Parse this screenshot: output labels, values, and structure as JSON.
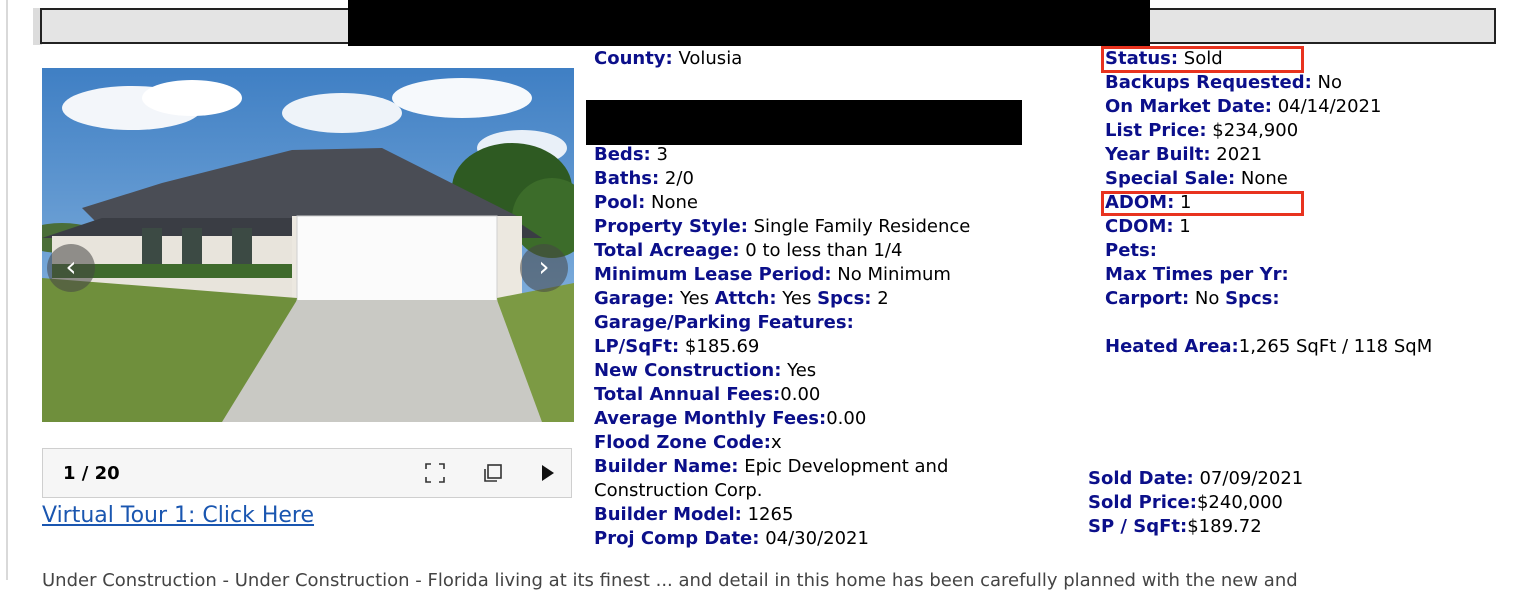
{
  "gallery": {
    "counter": "1 / 20",
    "tour_link": "Virtual Tour 1: Click Here"
  },
  "middle": [
    {
      "label": "County:",
      "value": " Volusia"
    },
    {
      "label": "Beds:",
      "value": " 3"
    },
    {
      "label": "Baths:",
      "value": " 2/0"
    },
    {
      "label": "Pool:",
      "value": " None"
    },
    {
      "label": "Property Style:",
      "value": " Single Family Residence"
    },
    {
      "label": "Total Acreage:",
      "value": " 0 to less than 1/4"
    },
    {
      "label": "Minimum Lease Period:",
      "value": " No Minimum"
    },
    {
      "label": "Garage:",
      "value": " Yes "
    },
    {
      "label": "Attch:",
      "value": " Yes "
    },
    {
      "label": "Spcs:",
      "value": " 2"
    },
    {
      "label": "Garage/Parking Features:",
      "value": ""
    },
    {
      "label": "LP/SqFt:",
      "value": " $185.69"
    },
    {
      "label": "New Construction:",
      "value": " Yes"
    },
    {
      "label": "Total Annual Fees:",
      "value": "0.00"
    },
    {
      "label": "Average Monthly Fees:",
      "value": "0.00"
    },
    {
      "label": "Flood Zone Code:",
      "value": "x"
    },
    {
      "label": "Builder Name:",
      "value": " Epic Development and"
    },
    {
      "label": "",
      "value": "Construction Corp."
    },
    {
      "label": "Builder Model:",
      "value": " 1265"
    },
    {
      "label": "Proj Comp Date:",
      "value": " 04/30/2021"
    }
  ],
  "right": [
    {
      "label": "Status:",
      "value": " Sold"
    },
    {
      "label": "Backups Requested:",
      "value": " No"
    },
    {
      "label": "On Market Date:",
      "value": " 04/14/2021"
    },
    {
      "label": "List Price:",
      "value": " $234,900"
    },
    {
      "label": "Year Built:",
      "value": " 2021"
    },
    {
      "label": "Special Sale:",
      "value": " None"
    },
    {
      "label": "ADOM:",
      "value": " 1"
    },
    {
      "label": "CDOM:",
      "value": " 1"
    },
    {
      "label": "Pets:",
      "value": ""
    },
    {
      "label": "Max Times per Yr:",
      "value": ""
    },
    {
      "label": "Carport:",
      "value": " No "
    },
    {
      "label": "Spcs:",
      "value": ""
    },
    {
      "label": "Heated Area:",
      "value": "1,265 SqFt / 118 SqM"
    }
  ],
  "sold": [
    {
      "label": "Sold Date:",
      "value": " 07/09/2021"
    },
    {
      "label": "Sold Price:",
      "value": "$240,000"
    },
    {
      "label": "SP / SqFt:",
      "value": "$189.72"
    }
  ],
  "remarks_cut": "Under Construction - Under Construction - Florida living at its finest ... and detail in this home has been carefully planned with the new and"
}
